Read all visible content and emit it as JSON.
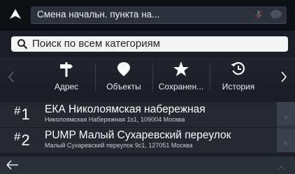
{
  "header": {
    "title": "Смена начальн. пункта на...",
    "nav_icon": "navigation-arrow-icon",
    "mic_icon": "microphone-icon",
    "chat_icon": "chat-bubble-icon"
  },
  "search": {
    "placeholder": "Поиск по всем категориям",
    "icon": "search-icon"
  },
  "categories": {
    "items": [
      {
        "label": "Адрес",
        "icon": "signpost-icon"
      },
      {
        "label": "Объекты",
        "icon": "map-pin-icon"
      },
      {
        "label": "Сохранен...",
        "icon": "star-icon"
      },
      {
        "label": "История",
        "icon": "history-icon"
      }
    ]
  },
  "results": [
    {
      "hash": "#",
      "rank": "1",
      "title": "ЕКА Николоямская набережная",
      "address": "Николоямская Набережная 1s1, 109004 Москва"
    },
    {
      "hash": "#",
      "rank": "2",
      "title": "PUMP Малый Сухаревский переулок",
      "address": "Малый Сухаревский переулок 9с1, 127051 Москва"
    }
  ],
  "colors": {
    "background": "#1a1e26",
    "topbar": "#0c0f14",
    "row": "#232831",
    "search_bg": "#f4f5f6"
  }
}
